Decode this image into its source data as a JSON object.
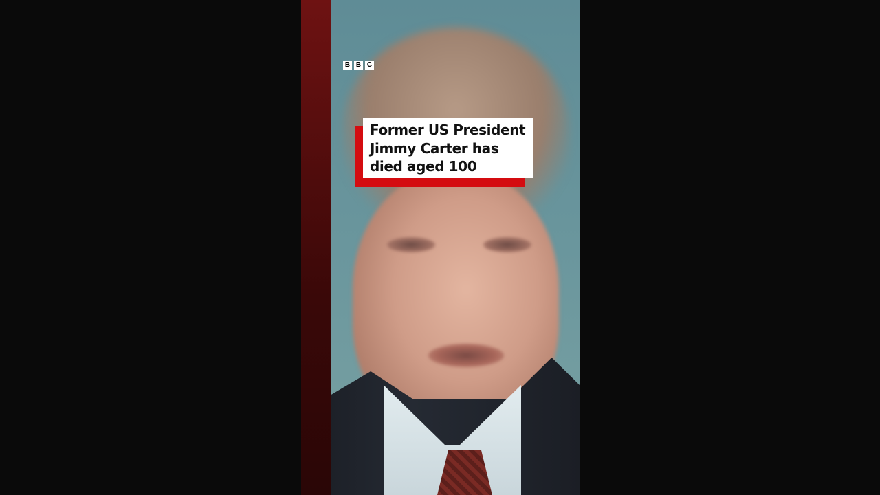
{
  "logo": {
    "letters": [
      "B",
      "B",
      "C"
    ]
  },
  "caption": {
    "lines": [
      "Former US President",
      "Jimmy Carter has",
      "died aged 100"
    ]
  },
  "colors": {
    "background": "#0a0a0a",
    "caption_accent": "#d40c10",
    "caption_box": "#ffffff",
    "caption_text": "#111111"
  }
}
